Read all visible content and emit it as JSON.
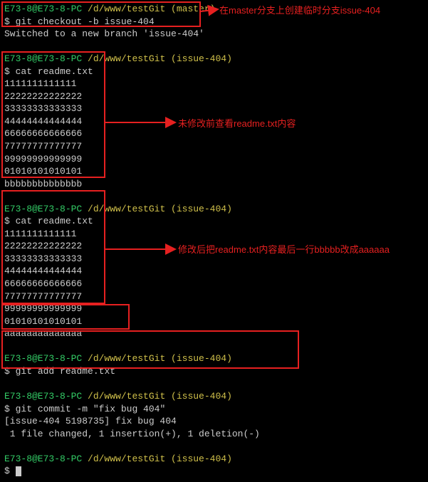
{
  "prompt": {
    "host": "E73-8@E73-8-PC",
    "path_master": "/d/www/testGit (master)",
    "path_issue": "/d/www/testGit (issue-404)"
  },
  "section1": {
    "cmd": "git checkout -b issue-404",
    "out": "Switched to a new branch 'issue-404'"
  },
  "section2": {
    "cmd": "cat readme.txt",
    "lines": [
      "1111111111111",
      "22222222222222",
      "33333333333333",
      "44444444444444",
      "66666666666666",
      "77777777777777",
      "99999999999999",
      "01010101010101",
      "bbbbbbbbbbbbbb"
    ]
  },
  "section3": {
    "cmd": "cat readme.txt",
    "lines": [
      "1111111111111",
      "22222222222222",
      "33333333333333",
      "44444444444444",
      "66666666666666",
      "77777777777777",
      "99999999999999",
      "01010101010101",
      "aaaaaaaaaaaaaa"
    ]
  },
  "section4": {
    "cmd": "git add readme.txt"
  },
  "section5": {
    "cmd": "git commit -m \"fix bug 404\"",
    "out1": "[issue-404 5198735] fix bug 404",
    "out2": " 1 file changed, 1 insertion(+), 1 deletion(-)"
  },
  "dollar": "$",
  "annotations": {
    "a1": "在master分支上创建临时分支issue-404",
    "a2": "未修改前查看readme.txt内容",
    "a3": "修改后把readme.txt内容最后一行bbbbb改成aaaaaa"
  }
}
